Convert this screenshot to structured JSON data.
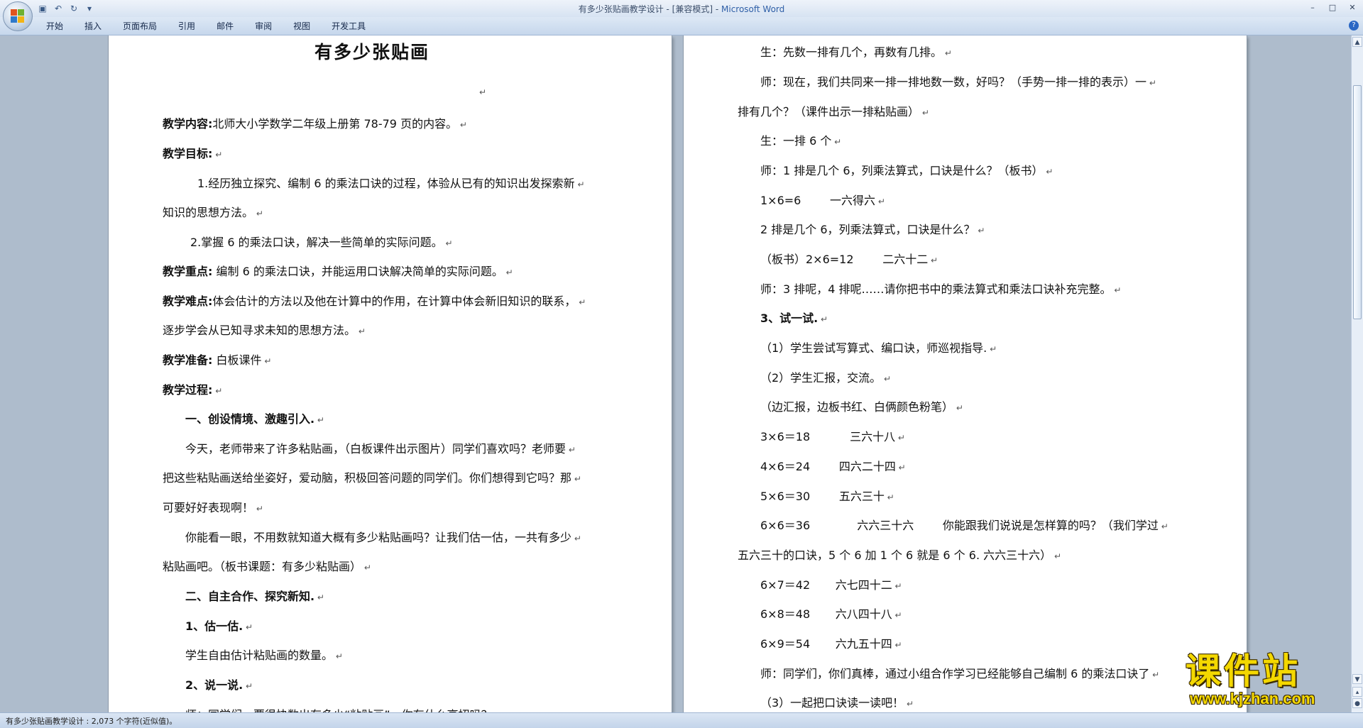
{
  "window": {
    "title_doc": "有多少张贴画教学设计 - [兼容模式] - ",
    "title_app": "Microsoft Word"
  },
  "ribbon": {
    "tabs": [
      "开始",
      "插入",
      "页面布局",
      "引用",
      "邮件",
      "审阅",
      "视图",
      "开发工具"
    ]
  },
  "document": {
    "left_page": {
      "title": "有多少张贴画",
      "lines": [
        {
          "label": "教学内容:",
          "text": "北师大小学数学二年级上册第 78-79 页的内容。"
        },
        {
          "label": "教学目标:",
          "text": ""
        },
        {
          "text": "1.经历独立探究、编制 6 的乘法口诀的过程，体验从已有的知识出发探索新"
        },
        {
          "text": "知识的思想方法。"
        },
        {
          "text": "2.掌握 6 的乘法口诀，解决一些简单的实际问题。"
        },
        {
          "label": "教学重点:",
          "text": " 编制 6 的乘法口诀，并能运用口诀解决简单的实际问题。"
        },
        {
          "label": "教学难点:",
          "text": "体会估计的方法以及他在计算中的作用，在计算中体会新旧知识的联系，"
        },
        {
          "text": "逐步学会从已知寻求未知的思想方法。"
        },
        {
          "label": "教学准备:",
          "text": " 白板课件"
        },
        {
          "label": "教学过程:",
          "text": ""
        },
        {
          "label": "一、创设情境、激趣引入.",
          "text": ""
        },
        {
          "text": "今天，老师带来了许多粘贴画，（白板课件出示图片）同学们喜欢吗？老师要"
        },
        {
          "text": "把这些粘贴画送给坐姿好，爱动脑，积极回答问题的同学们。你们想得到它吗？那"
        },
        {
          "text": "可要好好表现啊！"
        },
        {
          "text": "你能看一眼，不用数就知道大概有多少粘贴画吗？让我们估一估，一共有多少"
        },
        {
          "text": "粘贴画吧。（板书课题：有多少粘贴画）"
        },
        {
          "label": "二、自主合作、探究新知.",
          "text": ""
        },
        {
          "label": "1、估一估.",
          "text": ""
        },
        {
          "text": "学生自由估计粘贴画的数量。"
        },
        {
          "label": "2、说一说.",
          "text": ""
        },
        {
          "text": "师：同学们，要很快数出有多少“粘贴画”，你有什么高招吗？"
        }
      ]
    },
    "right_page": {
      "lines": [
        {
          "text": "生：先数一排有几个，再数有几排。"
        },
        {
          "text": "师：现在，我们共同来一排一排地数一数，好吗？（手势一排一排的表示）一"
        },
        {
          "text": "排有几个？（课件出示一排粘贴画）"
        },
        {
          "text": "生：一排 6 个"
        },
        {
          "text": "师：1 排是几个 6，列乘法算式，口诀是什么？（板书）"
        },
        {
          "text": "1×6=6        一六得六"
        },
        {
          "text": "2 排是几个 6，列乘法算式，口诀是什么？"
        },
        {
          "text": "（板书）2×6=12        二六十二"
        },
        {
          "text": "师：3 排呢，4 排呢……请你把书中的乘法算式和乘法口诀补充完整。"
        },
        {
          "label": "3、试一试.",
          "text": ""
        },
        {
          "text": "（1）学生尝试写算式、编口诀，师巡视指导."
        },
        {
          "text": "（2）学生汇报，交流。"
        },
        {
          "text": "（边汇报，边板书红、白俩颜色粉笔）"
        },
        {
          "text": "3×6＝18           三六十八"
        },
        {
          "text": "4×6＝24        四六二十四"
        },
        {
          "text": "5×6＝30        五六三十"
        },
        {
          "text": "6×6＝36             六六三十六        你能跟我们说说是怎样算的吗？（我们学过"
        },
        {
          "text": "五六三十的口诀，5 个 6 加 1 个 6 就是 6 个 6. 六六三十六）"
        },
        {
          "text": "6×7＝42       六七四十二"
        },
        {
          "text": "6×8＝48       六八四十八"
        },
        {
          "text": "6×9＝54       六九五十四"
        },
        {
          "text": "师：同学们，你们真棒，通过小组合作学习已经能够自己编制 6 的乘法口诀了"
        },
        {
          "text": "（3）一起把口诀读一读吧！"
        }
      ]
    }
  },
  "status": {
    "text": "有多少张贴画教学设计 : 2,073 个字符(近似值)。"
  },
  "watermark": {
    "cn": "课件站",
    "url": "www.kjzhan.com"
  }
}
